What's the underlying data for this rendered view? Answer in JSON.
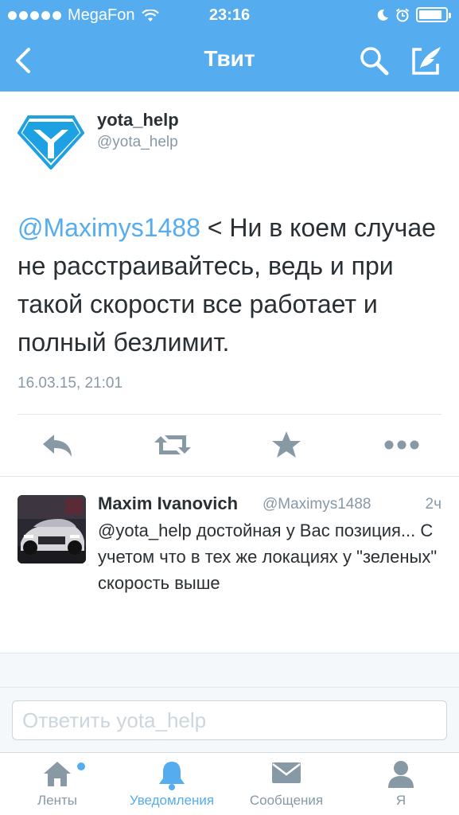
{
  "status_bar": {
    "carrier": "MegaFon",
    "time": "23:16"
  },
  "nav": {
    "title": "Твит",
    "icons": [
      "back-chevron-icon",
      "search-icon",
      "compose-icon"
    ]
  },
  "tweet": {
    "author_name": "yota_help",
    "author_handle": "@yota_help",
    "mention": "@Maximys1488",
    "text_rest": " < Ни в коем случае не расстраивайтесь, ведь и при такой скорости все работает и полный безлимит.",
    "date": "16.03.15, 21:01",
    "actions": [
      "reply-icon",
      "retweet-icon",
      "favorite-star-icon",
      "more-dots-icon"
    ]
  },
  "reply": {
    "author_name": "Maxim Ivanovich",
    "author_handle": "@Maximys1488",
    "age": "2ч",
    "text": "@yota_help достойная у Вас позиция... С учетом что в тех же локациях у \"зеленых\" скорость выше"
  },
  "reply_input": {
    "placeholder": "Ответить yota_help"
  },
  "tabbar": {
    "tabs": [
      {
        "label": "Ленты",
        "icon": "home-icon",
        "active": false
      },
      {
        "label": "Уведомления",
        "icon": "bell-icon",
        "active": true
      },
      {
        "label": "Сообщения",
        "icon": "envelope-icon",
        "active": false
      },
      {
        "label": "Я",
        "icon": "person-icon",
        "active": false
      }
    ]
  },
  "colors": {
    "brand_blue": "#55acee",
    "text_dark": "#292f33",
    "text_gray": "#8899a6",
    "icon_gray": "#8899a6"
  }
}
